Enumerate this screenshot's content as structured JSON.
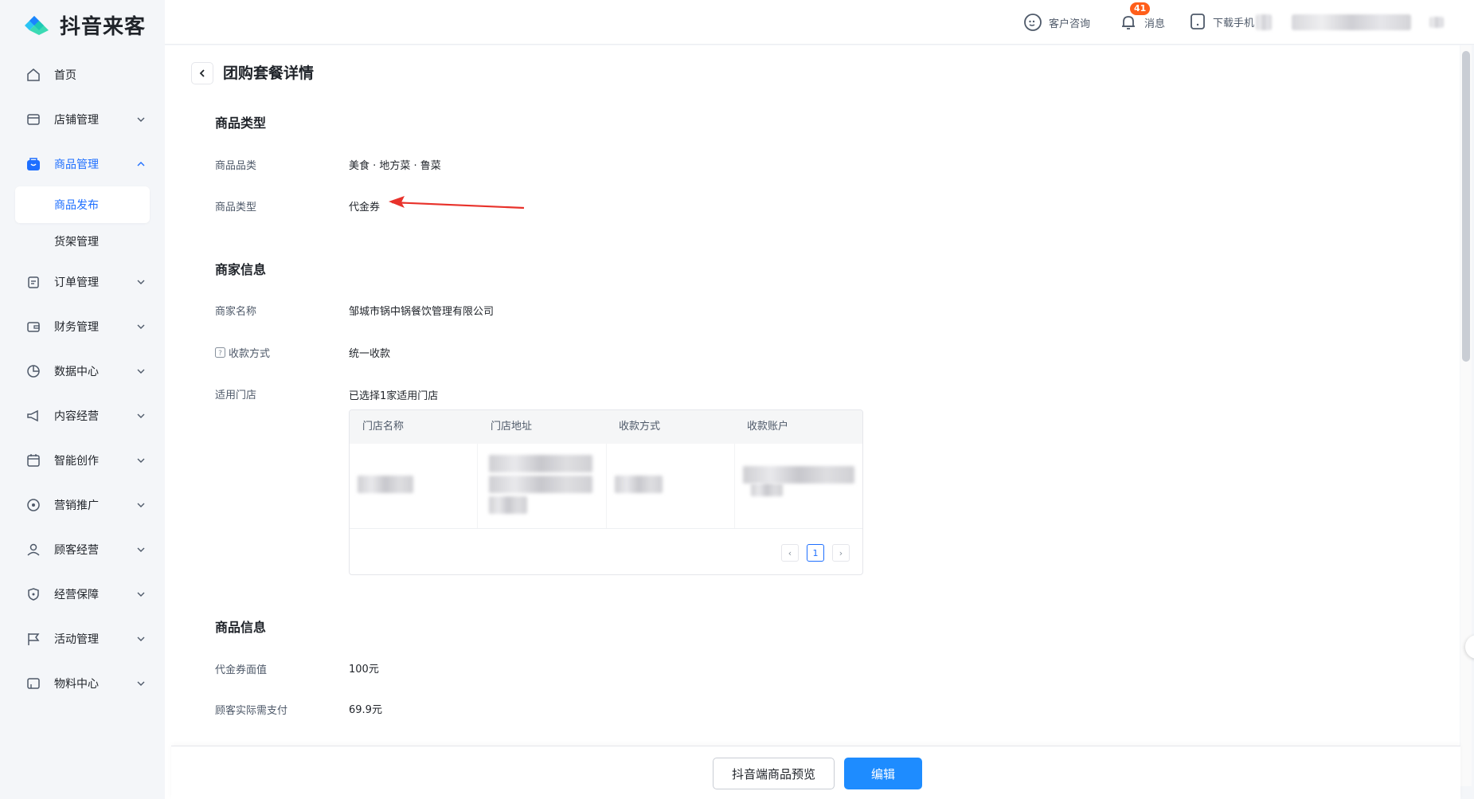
{
  "app": {
    "name": "抖音来客"
  },
  "sidebar": {
    "items": [
      {
        "label": "首页",
        "icon": "home-icon"
      },
      {
        "label": "店铺管理",
        "icon": "store-icon"
      },
      {
        "label": "商品管理",
        "icon": "bag-icon",
        "expanded": true,
        "children": [
          {
            "label": "商品发布",
            "selected": true
          },
          {
            "label": "货架管理"
          }
        ]
      },
      {
        "label": "订单管理",
        "icon": "clipboard-icon"
      },
      {
        "label": "财务管理",
        "icon": "wallet-icon"
      },
      {
        "label": "数据中心",
        "icon": "pie-chart-icon"
      },
      {
        "label": "内容经营",
        "icon": "megaphone-icon"
      },
      {
        "label": "智能创作",
        "icon": "calendar-icon"
      },
      {
        "label": "营销推广",
        "icon": "location-icon"
      },
      {
        "label": "顾客经营",
        "icon": "user-icon"
      },
      {
        "label": "经营保障",
        "icon": "shield-icon"
      },
      {
        "label": "活动管理",
        "icon": "flag-icon"
      },
      {
        "label": "物料中心",
        "icon": "box-icon"
      }
    ]
  },
  "topbar": {
    "support_label": "客户咨询",
    "messages_label": "消息",
    "messages_badge": "41",
    "download_label": "下载手机"
  },
  "page": {
    "title": "团购套餐详情",
    "sections": {
      "product_type": {
        "title": "商品类型",
        "category_label": "商品品类",
        "category_value": "美食 · 地方菜 · 鲁菜",
        "type_label": "商品类型",
        "type_value": "代金券"
      },
      "merchant": {
        "title": "商家信息",
        "name_label": "商家名称",
        "name_value": "邹城市锅中锅餐饮管理有限公司",
        "payment_label": "收款方式",
        "payment_value": "统一收款",
        "stores_label": "适用门店",
        "stores_value": "已选择1家适用门店",
        "table": {
          "columns": [
            "门店名称",
            "门店地址",
            "收款方式",
            "收款账户"
          ],
          "page": "1",
          "prev": "‹",
          "next": "›"
        }
      },
      "product_info": {
        "title": "商品信息",
        "face_value_label": "代金券面值",
        "face_value": "100元",
        "pay_label": "顾客实际需支付",
        "pay_value": "69.9元"
      }
    }
  },
  "footer": {
    "preview_label": "抖音端商品预览",
    "edit_label": "编辑"
  },
  "colors": {
    "accent": "#1e6fff",
    "primary_button": "#1e8cff",
    "badge": "#ff5e1a",
    "annotation": "#e8322b"
  }
}
